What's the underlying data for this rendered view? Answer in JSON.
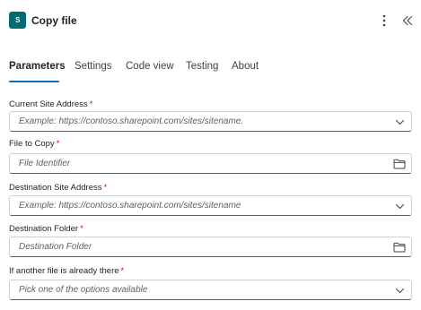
{
  "header": {
    "app_icon_text": "S",
    "title": "Copy file",
    "more_icon": "more-vertical-icon",
    "collapse_icon": "chevron-double-left-icon"
  },
  "tabs": [
    {
      "label": "Parameters",
      "active": true
    },
    {
      "label": "Settings",
      "active": false
    },
    {
      "label": "Code view",
      "active": false
    },
    {
      "label": "Testing",
      "active": false
    },
    {
      "label": "About",
      "active": false
    }
  ],
  "fields": [
    {
      "label": "Current Site Address",
      "required": "*",
      "placeholder": "Example: https://contoso.sharepoint.com/sites/sitename.",
      "icon": "chevron-down-icon"
    },
    {
      "label": "File to Copy",
      "required": "*",
      "placeholder": "File Identifier",
      "icon": "folder-icon"
    },
    {
      "label": "Destination Site Address",
      "required": "*",
      "placeholder": "Example: https://contoso.sharepoint.com/sites/sitename",
      "icon": "chevron-down-icon"
    },
    {
      "label": "Destination Folder",
      "required": "*",
      "placeholder": "Destination Folder",
      "icon": "folder-icon"
    },
    {
      "label": "If another file is already there",
      "required": "*",
      "placeholder": "Pick one of the options available",
      "icon": "chevron-down-icon"
    }
  ],
  "colors": {
    "accent": "#0f6cbd",
    "app_icon_bg": "#036c70",
    "required": "#c50f1f"
  }
}
